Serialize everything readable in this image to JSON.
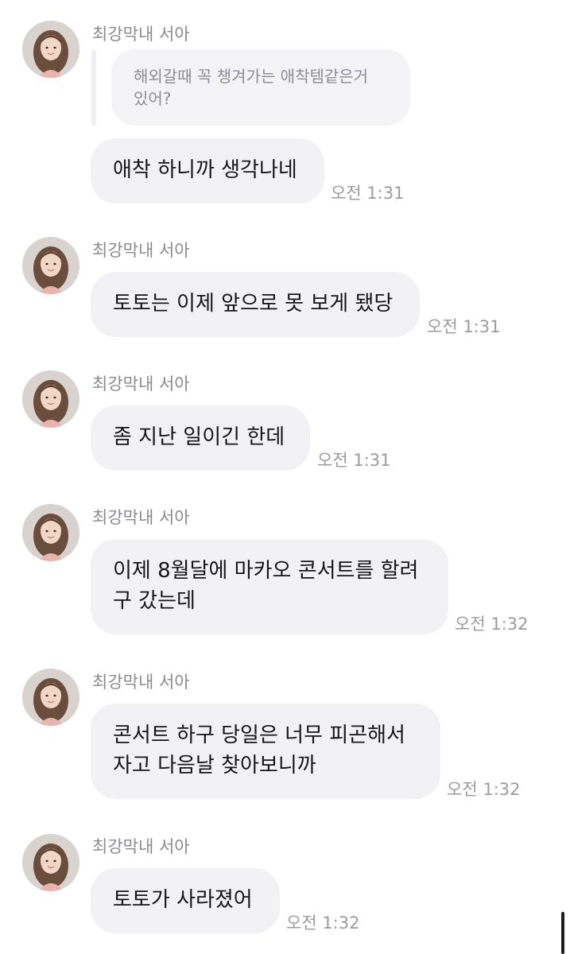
{
  "chat": {
    "sender_name": "최강막내 서아",
    "reply_quote": "해외갈때 꼭 챙겨가는 애착템같은거\n있어?",
    "groups": [
      {
        "messages": [
          {
            "text": "애착 하니까 생각나네",
            "time": "오전 1:31"
          }
        ]
      },
      {
        "messages": [
          {
            "text": "토토는 이제 앞으로 못 보게 됐당",
            "time": "오전 1:31"
          }
        ]
      },
      {
        "messages": [
          {
            "text": "좀 지난 일이긴 한데",
            "time": "오전 1:31"
          }
        ]
      },
      {
        "messages": [
          {
            "text": "이제 8월달에 마카오 콘서트를 할려\n구 갔는데",
            "time": "오전 1:32"
          }
        ]
      },
      {
        "messages": [
          {
            "text": "콘서트 하구 당일은 너무 피곤해서\n자고 다음날 찾아보니까",
            "time": "오전 1:32"
          }
        ]
      },
      {
        "messages": [
          {
            "text": "토토가 사라졌어",
            "time": "오전 1:32"
          }
        ]
      }
    ]
  },
  "icons": {
    "avatar": "profile-photo",
    "scroll": "scroll-indicator"
  },
  "colors": {
    "bubble_background": "#f2f2f5",
    "name_text": "#8a8a8e",
    "time_text": "#9b9b9f",
    "quote_text": "#8d8d91"
  }
}
